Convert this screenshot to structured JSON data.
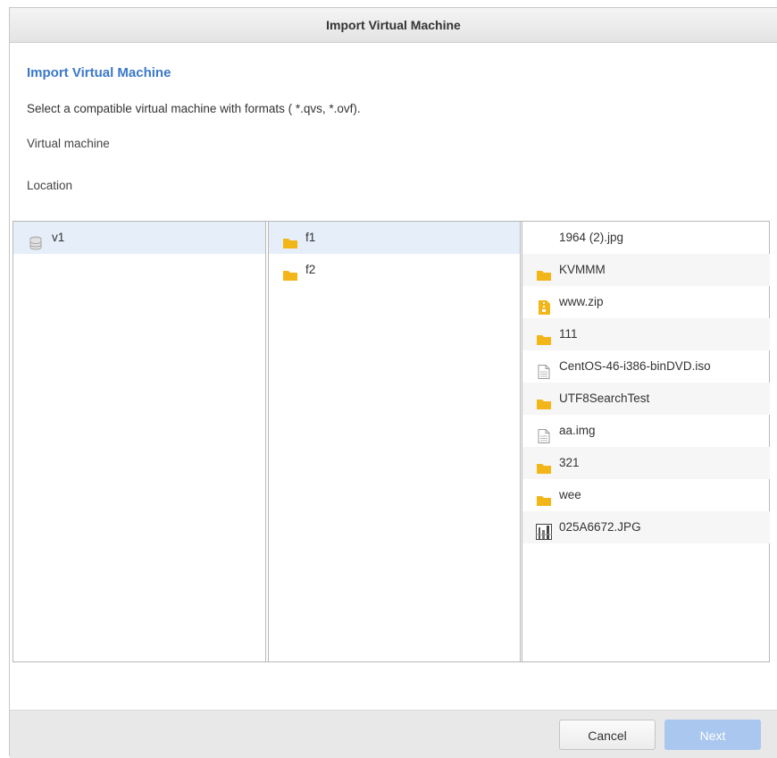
{
  "dialog": {
    "title": "Import Virtual Machine",
    "heading": "Import Virtual Machine",
    "description": "Select a compatible virtual machine with formats ( *.qvs, *.ovf).",
    "virtual_machine_label": "Virtual machine",
    "location_label": "Location"
  },
  "browser": {
    "column1": [
      {
        "label": "v1",
        "icon": "storage-icon"
      }
    ],
    "column2": [
      {
        "label": "f1",
        "icon": "folder-icon"
      },
      {
        "label": "f2",
        "icon": "folder-icon"
      }
    ],
    "column3": [
      {
        "label": "1964 (2).jpg",
        "icon": "none"
      },
      {
        "label": "KVMMM",
        "icon": "folder-icon"
      },
      {
        "label": "www.zip",
        "icon": "zip-icon"
      },
      {
        "label": "111",
        "icon": "folder-icon"
      },
      {
        "label": "CentOS-46-i386-binDVD.iso",
        "icon": "file-icon"
      },
      {
        "label": "UTF8SearchTest",
        "icon": "folder-icon"
      },
      {
        "label": "aa.img",
        "icon": "file-icon"
      },
      {
        "label": "321",
        "icon": "folder-icon"
      },
      {
        "label": "wee",
        "icon": "folder-icon"
      },
      {
        "label": "025A6672.JPG",
        "icon": "image-thumbnail-icon"
      }
    ]
  },
  "footer": {
    "cancel_label": "Cancel",
    "next_label": "Next"
  },
  "colors": {
    "accent": "#3b78c9",
    "folder": "#f2b619",
    "selection": "#e6eef9",
    "next_disabled": "#a9c7ef"
  }
}
